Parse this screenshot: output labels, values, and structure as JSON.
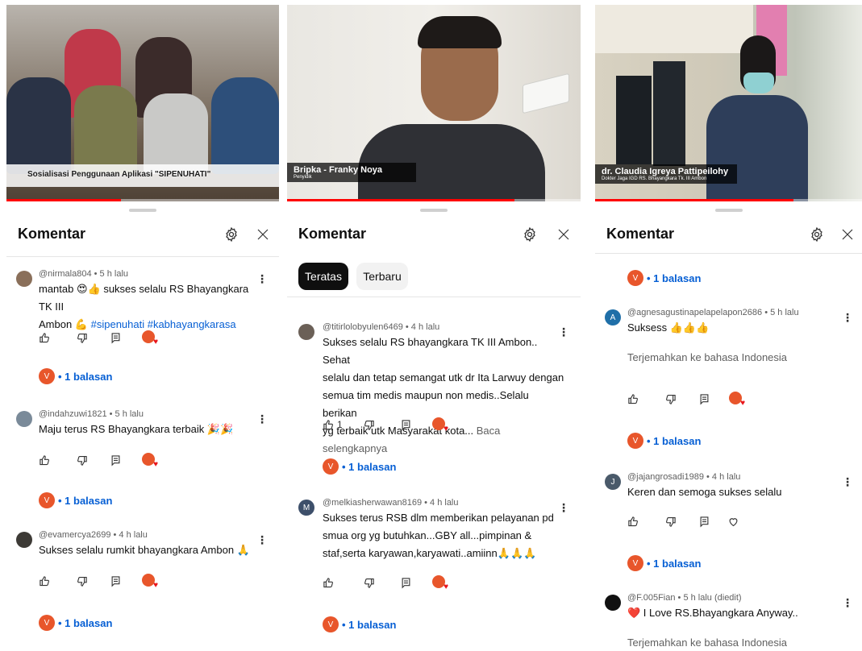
{
  "panels": [
    {
      "video": {
        "caption": "Sosialisasi Penggunaan Aplikasi \"SIPENUHATI\""
      },
      "title": "Komentar",
      "comments": [
        {
          "meta": "@nirmala804 • 5 h lalu",
          "line1": "mantab 😍👍 sukses selalu RS Bhayangkara TK III",
          "line2_prefix": "Ambon 💪 ",
          "line2_tags": "#sipenuhati #kabhayangkarasa",
          "replies": "• 1 balasan"
        },
        {
          "meta": "@indahzuwi1821 • 5 h lalu",
          "line1": "Maju terus RS Bhayangkara terbaik 🎉🎉",
          "replies": "• 1 balasan"
        },
        {
          "meta": "@evamercya2699 • 4 h lalu",
          "line1": "Sukses selalu rumkit bhayangkara Ambon 🙏",
          "replies": "• 1 balasan"
        }
      ]
    },
    {
      "video": {
        "name": "Bripka - Franky Noya",
        "role": "Penyidik"
      },
      "title": "Komentar",
      "chips": [
        "Teratas",
        "Terbaru"
      ],
      "comments": [
        {
          "meta": "@titirlolobyulen6469 • 4 h lalu",
          "line1": "Sukses selalu RS bhayangkara TK III Ambon.. Sehat",
          "line2": "selalu dan tetap semangat utk dr Ita Larwuy dengan",
          "line3": "semua tim medis maupun non medis..Selalu berikan",
          "line4": "yg terbaik utk Masyarakat kota...",
          "more": " Baca selengkapnya",
          "likes": "1",
          "replies": "• 1 balasan",
          "avatar": ""
        },
        {
          "meta": "@melkiasherwawan8169 • 4 h lalu",
          "line1": "Sukses terus RSB dlm memberikan pelayanan pd",
          "line2": "smua org yg butuhkan...GBY all...pimpinan &",
          "line3": "staf,serta karyawan,karyawati..amiinn🙏🙏🙏",
          "replies": "• 1 balasan",
          "avatar": "M"
        }
      ]
    },
    {
      "video": {
        "name": "dr. Claudia Igreya Pattipeilohy",
        "role": "Dokter Jaga IGD RS. Bhayangkara Tk. III Ambon"
      },
      "title": "Komentar",
      "top_replies": "• 1 balasan",
      "comments": [
        {
          "meta": "@agnesagustinapelapelapon2686 • 5 h lalu",
          "line1": "Suksess 👍👍👍",
          "translate": "Terjemahkan ke bahasa Indonesia",
          "replies": "• 1 balasan",
          "avatar": "A"
        },
        {
          "meta": "@jajangrosadi1989 • 4 h lalu",
          "line1": "Keren dan semoga sukses selalu",
          "replies": "• 1 balasan",
          "avatar": "J"
        },
        {
          "meta": "@F.005Fian • 5 h lalu (diedit)",
          "line1": "❤️ I Love RS.Bhayangkara Anyway..",
          "translate": "Terjemahkan ke bahasa Indonesia",
          "avatar": ""
        }
      ]
    }
  ],
  "reply_avatar_letter": "V",
  "colors": {
    "link": "#065fd4",
    "progress": "#ff0000",
    "reply_avatar": "#e8562b",
    "avatar_m": "#3d4f6a",
    "avatar_a": "#1f6fa8",
    "avatar_j": "#4a5a6a"
  },
  "icons": [
    "settings-icon",
    "close-icon",
    "thumb-up-icon",
    "thumb-down-icon",
    "reply-icon",
    "creator-heart-icon",
    "heart-outline-icon",
    "more-vert-icon"
  ]
}
